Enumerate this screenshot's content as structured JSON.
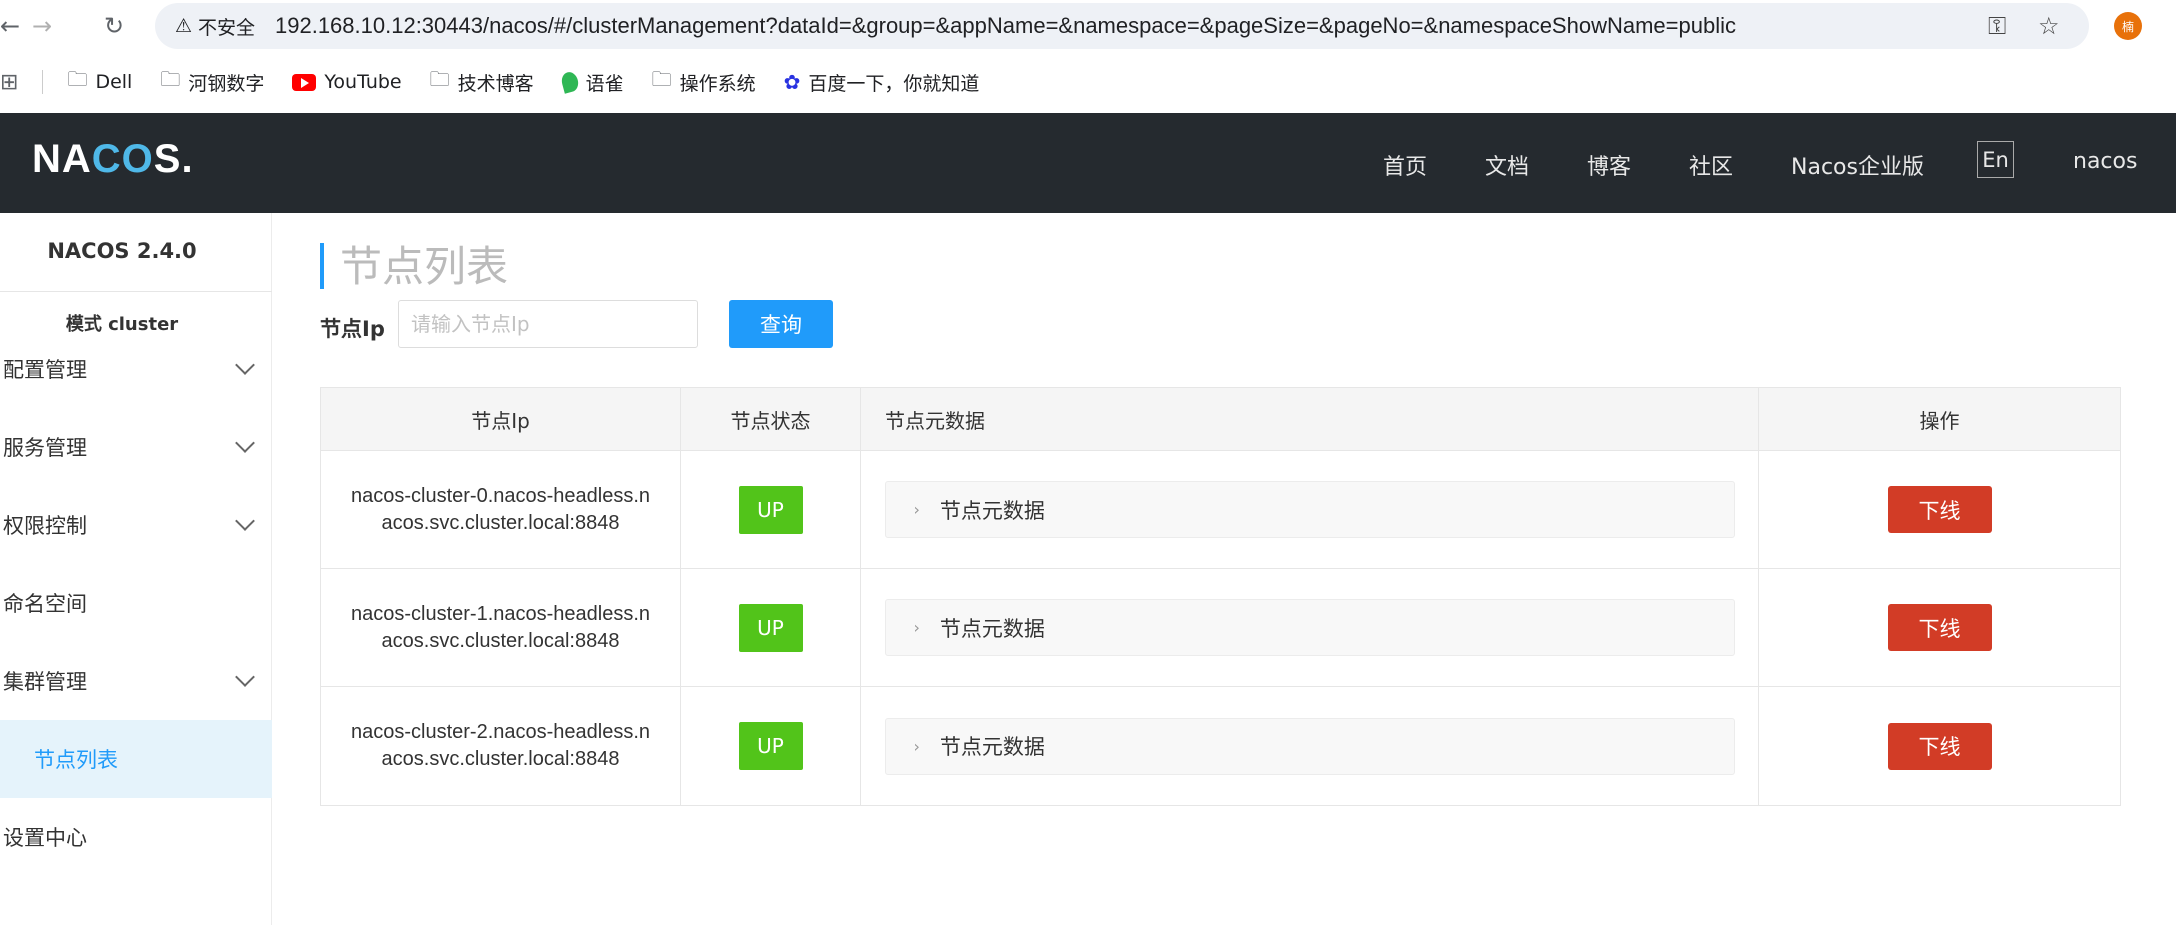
{
  "browser": {
    "security_label": "不安全",
    "url": "192.168.10.12:30443/nacos/#/clusterManagement?dataId=&group=&appName=&namespace=&pageSize=&pageNo=&namespaceShowName=public",
    "profile_initial": "楠",
    "bookmarks": [
      {
        "label": "Dell",
        "icon": "folder-icon"
      },
      {
        "label": "河钢数字",
        "icon": "folder-icon"
      },
      {
        "label": "YouTube",
        "icon": "youtube-icon"
      },
      {
        "label": "技术博客",
        "icon": "folder-icon"
      },
      {
        "label": "语雀",
        "icon": "yuque-icon"
      },
      {
        "label": "操作系统",
        "icon": "folder-icon"
      },
      {
        "label": "百度一下，你就知道",
        "icon": "baidu-icon"
      }
    ]
  },
  "header": {
    "logo": "NACOS.",
    "nav": [
      "首页",
      "文档",
      "博客",
      "社区",
      "Nacos企业版"
    ],
    "lang_button": "En",
    "user": "nacos",
    "accent": "#209bfa",
    "bg": "#252a2f"
  },
  "sidebar": {
    "version": "NACOS 2.4.0",
    "mode": "模式 cluster",
    "items": [
      {
        "label": "配置管理",
        "expandable": true
      },
      {
        "label": "服务管理",
        "expandable": true
      },
      {
        "label": "权限控制",
        "expandable": true
      },
      {
        "label": "命名空间",
        "expandable": false
      },
      {
        "label": "集群管理",
        "expandable": true
      },
      {
        "label": "节点列表",
        "expandable": false,
        "active": true
      },
      {
        "label": "设置中心",
        "expandable": false
      }
    ]
  },
  "main": {
    "title": "节点列表",
    "filter_label": "节点Ip",
    "filter_placeholder": "请输入节点Ip",
    "query_button": "查询",
    "table": {
      "headers": [
        "节点Ip",
        "节点状态",
        "节点元数据",
        "操作"
      ],
      "rows": [
        {
          "ip": "nacos-cluster-0.nacos-headless.nacos.svc.cluster.local:8848",
          "status": "UP",
          "metadata": "节点元数据",
          "action": "下线"
        },
        {
          "ip": "nacos-cluster-1.nacos-headless.nacos.svc.cluster.local:8848",
          "status": "UP",
          "metadata": "节点元数据",
          "action": "下线"
        },
        {
          "ip": "nacos-cluster-2.nacos-headless.nacos.svc.cluster.local:8848",
          "status": "UP",
          "metadata": "节点元数据",
          "action": "下线"
        }
      ]
    },
    "status_color": "#52c41a",
    "danger_color": "#d23c26"
  }
}
